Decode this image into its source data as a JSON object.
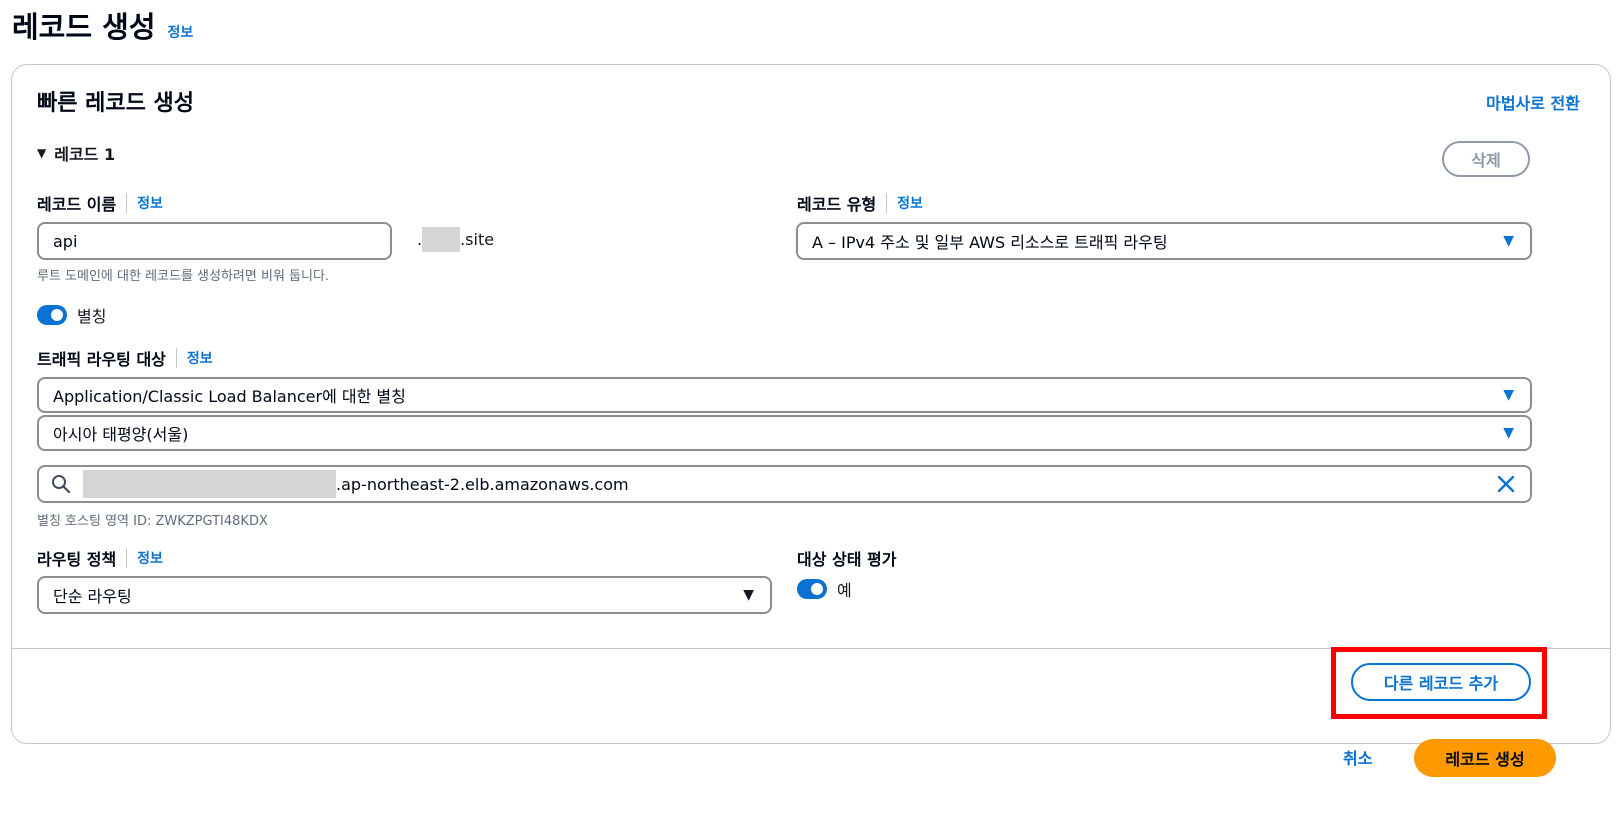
{
  "page": {
    "title": "레코드 생성",
    "info": "정보"
  },
  "panel": {
    "title": "빠른 레코드 생성",
    "wizard_link": "마법사로 전환",
    "record_toggle": "레코드 1",
    "delete": "삭제"
  },
  "record_name": {
    "label": "레코드 이름",
    "info": "정보",
    "value": "api",
    "suffix_dot": ".",
    "suffix_tld": ".site",
    "hint": "루트 도메인에 대한 레코드를 생성하려면 비워 둡니다."
  },
  "record_type": {
    "label": "레코드 유형",
    "info": "정보",
    "value": "A – IPv4 주소 및 일부 AWS 리소스로 트래픽 라우팅"
  },
  "alias": {
    "label": "별칭"
  },
  "traffic_target": {
    "label": "트래픽 라우팅 대상",
    "info": "정보",
    "endpoint": "Application/Classic Load Balancer에 대한 별칭",
    "region": "아시아 태평양(서울)",
    "search_suffix": ".ap-northeast-2.elb.amazonaws.com",
    "hosted_zone": "별칭 호스팅 영역 ID: ZWKZPGTI48KDX"
  },
  "routing_policy": {
    "label": "라우팅 정책",
    "info": "정보",
    "value": "단순 라우팅"
  },
  "health": {
    "label": "대상 상태 평가",
    "toggle_label": "예"
  },
  "footer": {
    "add_record": "다른 레코드 추가",
    "cancel": "취소",
    "create": "레코드 생성"
  },
  "colors": {
    "primary": "#0972d3",
    "orange": "#ff9900",
    "highlight": "#ff0000"
  },
  "icons": {
    "search": "search-icon",
    "clear": "close-icon",
    "caret": "caret-down-icon"
  }
}
